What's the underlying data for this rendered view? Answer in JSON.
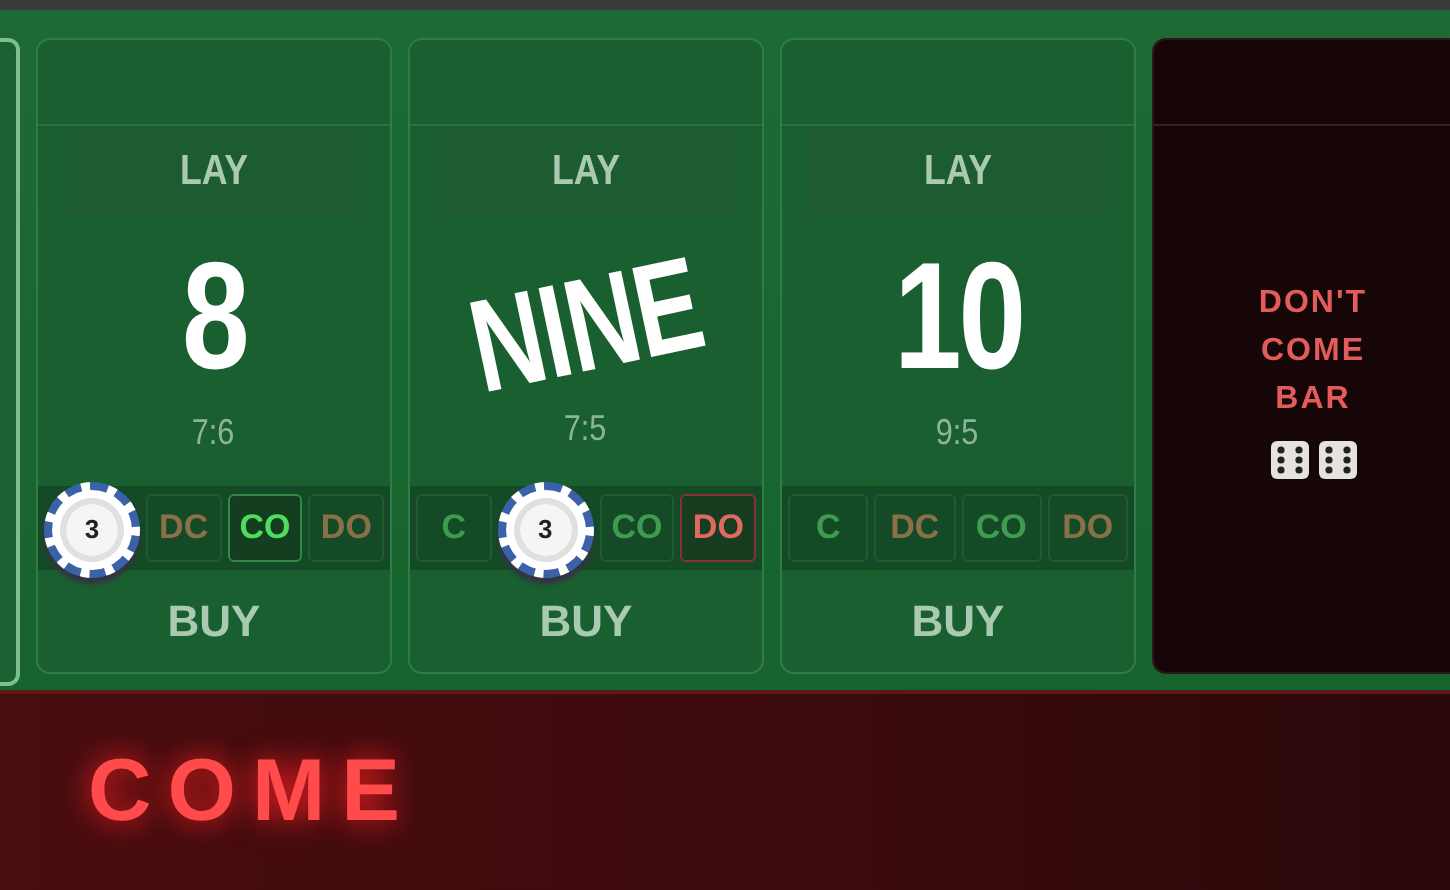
{
  "points": [
    {
      "lay": "LAY",
      "number": "8",
      "kind": "numeral",
      "odds": "7:6",
      "buy": "BUY",
      "bets": [
        {
          "kind": "chip",
          "label": "3"
        },
        {
          "kind": "dontcome",
          "label": "DC",
          "active": false
        },
        {
          "kind": "come",
          "label": "CO",
          "active": true
        },
        {
          "kind": "dontcome",
          "label": "DO",
          "active": false
        }
      ]
    },
    {
      "lay": "LAY",
      "number": "NINE",
      "kind": "word",
      "odds": "7:5",
      "buy": "BUY",
      "bets": [
        {
          "kind": "come",
          "label": "C",
          "active": false
        },
        {
          "kind": "chip",
          "label": "3"
        },
        {
          "kind": "come",
          "label": "CO",
          "active": false
        },
        {
          "kind": "dontcome",
          "label": "DO",
          "active": true
        }
      ]
    },
    {
      "lay": "LAY",
      "number": "10",
      "kind": "numeral",
      "odds": "9:5",
      "buy": "BUY",
      "bets": [
        {
          "kind": "come",
          "label": "C",
          "active": false
        },
        {
          "kind": "dontcome",
          "label": "DC",
          "active": false
        },
        {
          "kind": "come",
          "label": "CO",
          "active": false
        },
        {
          "kind": "dontcome",
          "label": "DO",
          "active": false
        }
      ]
    }
  ],
  "dont_come_bar": {
    "lines": [
      "DON'T",
      "COME",
      "BAR"
    ]
  },
  "come_bar": {
    "label": "COME"
  }
}
